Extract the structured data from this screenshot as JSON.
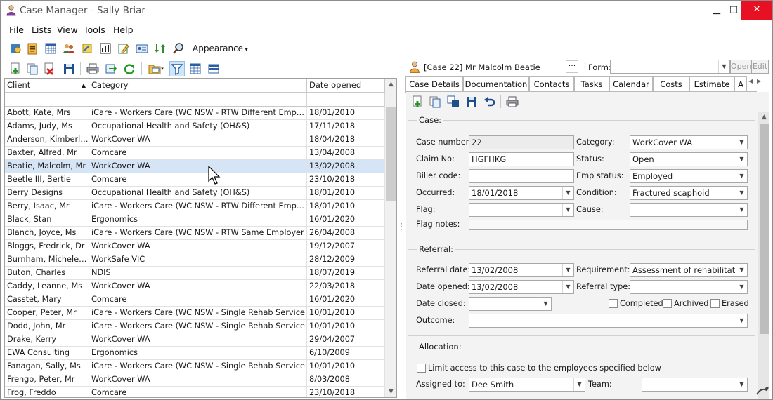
{
  "window": {
    "title": "Case Manager - Sally Briar",
    "controls": {
      "minimize": "▁",
      "maximize": "□",
      "close": "✕"
    }
  },
  "menu": [
    "File",
    "Lists",
    "View",
    "Tools",
    "Help"
  ],
  "toolbar": {
    "appearance_label": "Appearance"
  },
  "grid": {
    "columns": [
      "Client",
      "Category",
      "Date opened"
    ],
    "rows": [
      {
        "client": "Abott, Kate, Mrs",
        "category": "iCare - Workers Care (WC NSW - RTW Different Employer)",
        "date": "18/01/2010"
      },
      {
        "client": "Adams, Judy, Ms",
        "category": "Occupational Health and Safety (OH&S)",
        "date": "17/11/2018"
      },
      {
        "client": "Anderson, Kimberly, ...",
        "category": "WorkCover WA",
        "date": "18/04/2018"
      },
      {
        "client": "Baxter, Alfred, Mr",
        "category": "Comcare",
        "date": "13/04/2008"
      },
      {
        "client": "Beatie, Malcolm, Mr",
        "category": "WorkCover WA",
        "date": "13/02/2008",
        "selected": true
      },
      {
        "client": "Beetle III, Bertie",
        "category": "Comcare",
        "date": "23/10/2018"
      },
      {
        "client": "Berry Designs",
        "category": "Occupational Health and Safety (OH&S)",
        "date": "18/01/2010"
      },
      {
        "client": "Berry, Isaac, Mr",
        "category": "iCare - Workers Care (WC NSW - RTW Different Employer)",
        "date": "18/01/2010"
      },
      {
        "client": "Black, Stan",
        "category": "Ergonomics",
        "date": "16/01/2020"
      },
      {
        "client": "Blanch, Joyce, Ms",
        "category": "iCare - Workers Care (WC NSW - RTW Same Employer",
        "date": "26/04/2008"
      },
      {
        "client": "Bloggs, Fredrick, Dr",
        "category": "WorkCover WA",
        "date": "19/12/2007"
      },
      {
        "client": "Burnham, Michele, Mrs",
        "category": "WorkSafe VIC",
        "date": "28/12/2009"
      },
      {
        "client": "Buton, Charles",
        "category": "NDIS",
        "date": "18/07/2019"
      },
      {
        "client": "Caddy, Leanne, Ms",
        "category": "WorkCover WA",
        "date": "22/03/2018"
      },
      {
        "client": "Casstet, Mary",
        "category": "Comcare",
        "date": "16/01/2020"
      },
      {
        "client": "Cooper, Peter, Mr",
        "category": "iCare - Workers Care (WC NSW - Single Rehab Service",
        "date": "10/01/2010"
      },
      {
        "client": "Dodd, John, Mr",
        "category": "iCare - Workers Care (WC NSW - Single Rehab Service",
        "date": "10/01/2010"
      },
      {
        "client": "Drake, Kerry",
        "category": "WorkCover WA",
        "date": "29/04/2007"
      },
      {
        "client": "EWA Consulting",
        "category": "Ergonomics",
        "date": "6/10/2009"
      },
      {
        "client": "Fanagan, Sally, Ms",
        "category": "iCare - Workers Care (WC NSW - Single Rehab Service",
        "date": "10/01/2010"
      },
      {
        "client": "Frengo, Peter, Mr",
        "category": "WorkCover WA",
        "date": "8/03/2008"
      },
      {
        "client": "Frog, Freddo",
        "category": "Comcare",
        "date": "23/10/2018"
      }
    ]
  },
  "case_header": {
    "title": "[Case 22] Mr Malcolm Beatie",
    "more_label": "···",
    "form_label": "Form:",
    "form_value": "",
    "open_label": "Open",
    "edit_label": "Edit"
  },
  "tabs": [
    "Case Details",
    "Documentation",
    "Contacts",
    "Tasks",
    "Calendar",
    "Costs",
    "Estimate",
    "A"
  ],
  "case_section": {
    "title": "Case:",
    "case_number_label": "Case number:",
    "case_number": "22",
    "category_label": "Category:",
    "category": "WorkCover WA",
    "claim_label": "Claim No:",
    "claim": "HGFHKG",
    "status_label": "Status:",
    "status": "Open",
    "biller_label": "Biller code:",
    "biller": "",
    "emp_status_label": "Emp status:",
    "emp_status": "Employed",
    "occurred_label": "Occurred:",
    "occurred": "18/01/2018",
    "condition_label": "Condition:",
    "condition": "Fractured scaphoid",
    "flag_label": "Flag:",
    "flag": "",
    "cause_label": "Cause:",
    "cause": "",
    "flag_notes_label": "Flag notes:",
    "flag_notes": ""
  },
  "referral_section": {
    "title": "Referral:",
    "referral_date_label": "Referral date:",
    "referral_date": "13/02/2008",
    "requirement_label": "Requirement:",
    "requirement": "Assessment of rehabilitation n",
    "date_opened_label": "Date opened:",
    "date_opened": "13/02/2008",
    "referral_type_label": "Referral type:",
    "referral_type": "",
    "date_closed_label": "Date closed:",
    "date_closed": "",
    "completed_label": "Completed",
    "archived_label": "Archived",
    "erased_label": "Erased",
    "outcome_label": "Outcome:",
    "outcome": ""
  },
  "allocation_section": {
    "title": "Allocation:",
    "limit_label": "Limit access to this case to the employees specified below",
    "assigned_label": "Assigned to:",
    "assigned": "Dee Smith",
    "team_label": "Team:",
    "team": ""
  }
}
